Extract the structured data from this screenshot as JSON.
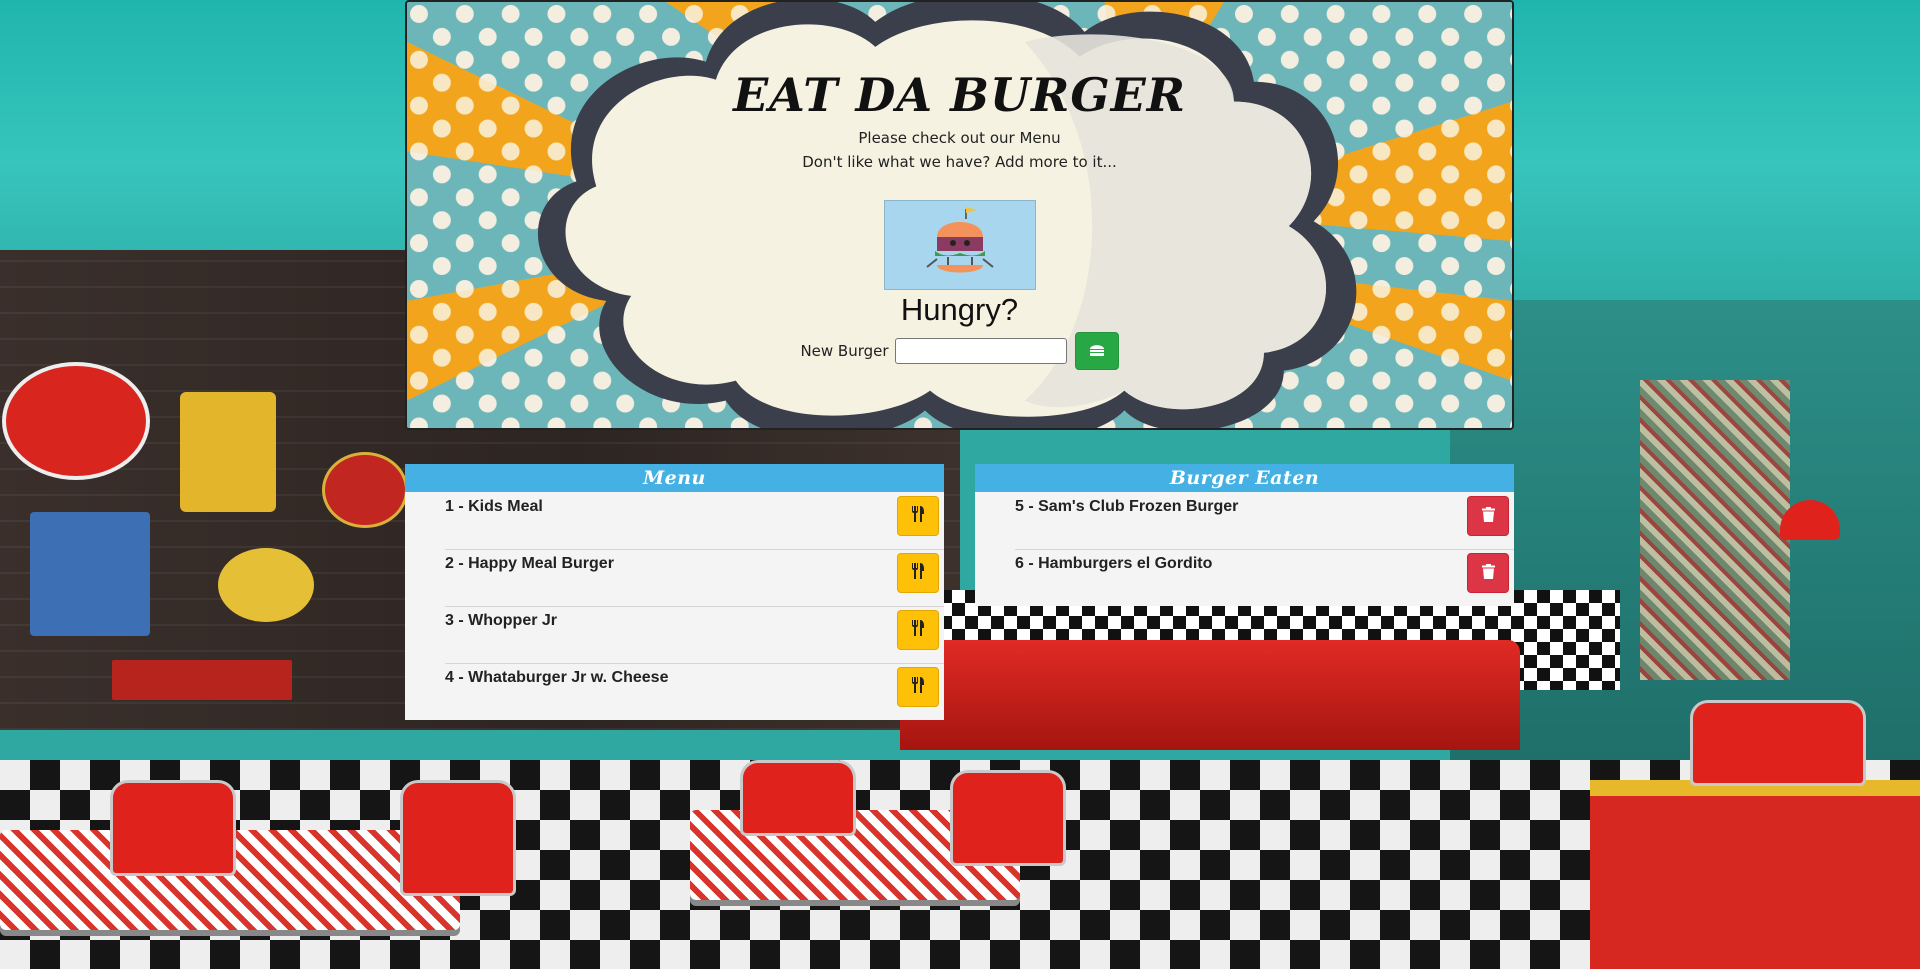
{
  "header": {
    "title": "EAT DA BURGER",
    "subtitle_1": "Please check out our Menu",
    "subtitle_2": "Don't like what we have? Add more to it...",
    "hungry": "Hungry?",
    "new_burger_label": "New Burger",
    "new_burger_value": "",
    "add_icon": "burger-icon"
  },
  "menu": {
    "title": "Menu",
    "action_icon": "utensils-icon",
    "items": [
      {
        "label": "1 - Kids Meal"
      },
      {
        "label": "2 - Happy Meal Burger"
      },
      {
        "label": "3 - Whopper Jr"
      },
      {
        "label": "4 - Whataburger Jr w. Cheese"
      }
    ]
  },
  "eaten": {
    "title": "Burger Eaten",
    "action_icon": "trash-icon",
    "items": [
      {
        "label": "5 - Sam's Club Frozen Burger"
      },
      {
        "label": "6 - Hamburgers el Gordito"
      }
    ]
  },
  "colors": {
    "header_bar": "#45b0e3",
    "eat_button": "#ffc107",
    "delete_button": "#dc3545",
    "add_button": "#28a745"
  }
}
